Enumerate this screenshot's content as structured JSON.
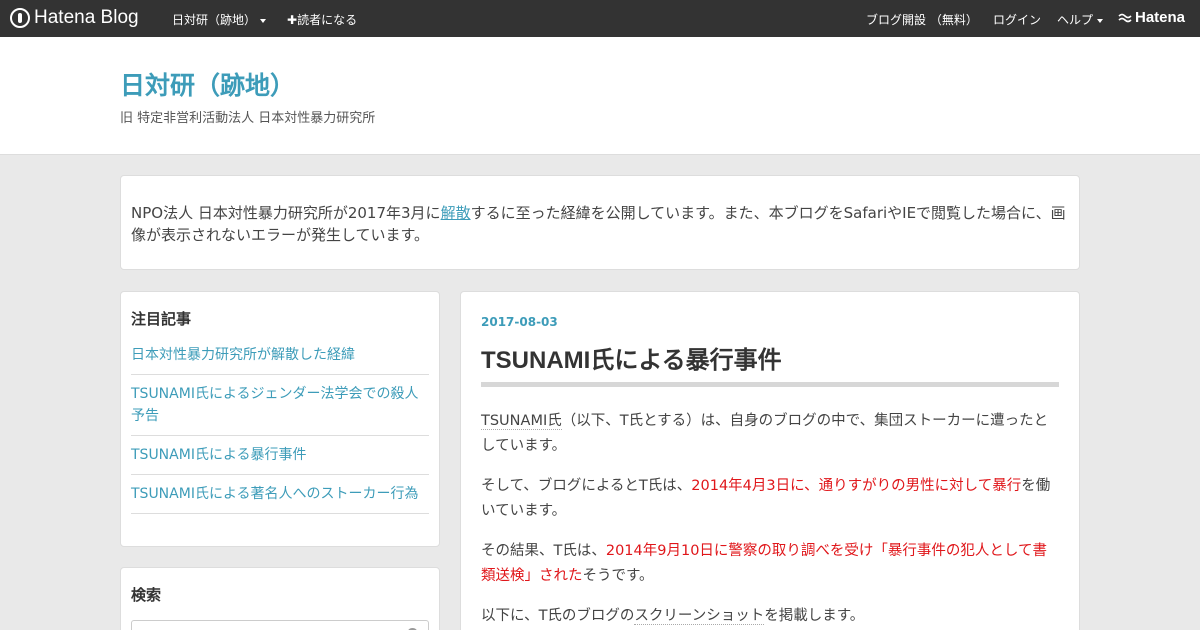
{
  "globalbar": {
    "logo_text": "Hatena Blog",
    "blog_menu": "日対研（跡地）",
    "subscribe": "読者になる",
    "open_blog": "ブログ開設 （無料）",
    "login": "ログイン",
    "help": "ヘルプ",
    "hatena": "Hatena"
  },
  "header": {
    "title": "日対研（跡地）",
    "description": "旧 特定非営利活動法人 日本対性暴力研究所"
  },
  "notice": {
    "text_before": "NPO法人 日本対性暴力研究所が2017年3月に",
    "link": "解散",
    "text_after": "するに至った経緯を公開しています。また、本ブログをSafariやIEで閲覧した場合に、画像が表示されないエラーが発生しています。"
  },
  "sidebar": {
    "featured_heading": "注目記事",
    "featured_items": [
      "日本対性暴力研究所が解散した経緯",
      "TSUNAMI氏によるジェンダー法学会での殺人予告",
      "TSUNAMI氏による暴行事件",
      "TSUNAMI氏による著名人へのストーカー行為"
    ],
    "search_heading": "検索"
  },
  "post": {
    "date": "2017-08-03",
    "title": "TSUNAMI氏による暴行事件",
    "p1_a": "TSUNAMI氏",
    "p1_b": "（以下、T氏とする）は、自身のブログの中で、集団ストーカーに遭ったとしています。",
    "p2_a": "そして、ブログによるとT氏は、",
    "p2_red": "2014年4月3日に、通りすがりの男性に対して暴行",
    "p2_b": "を働いています。",
    "p3_a": "その結果、T氏は、",
    "p3_red": "2014年9月10日に警察の取り調べを受け「暴行事件の犯人として書類送検」された",
    "p3_b": "そうです。",
    "p4_a": "以下に、T氏のブログの",
    "p4_link": "スクリーンショット",
    "p4_b": "を掲載します。"
  },
  "colors": {
    "accent": "#3d9cb9",
    "highlight_red": "#e0161a",
    "globalbar_bg": "#333333"
  }
}
